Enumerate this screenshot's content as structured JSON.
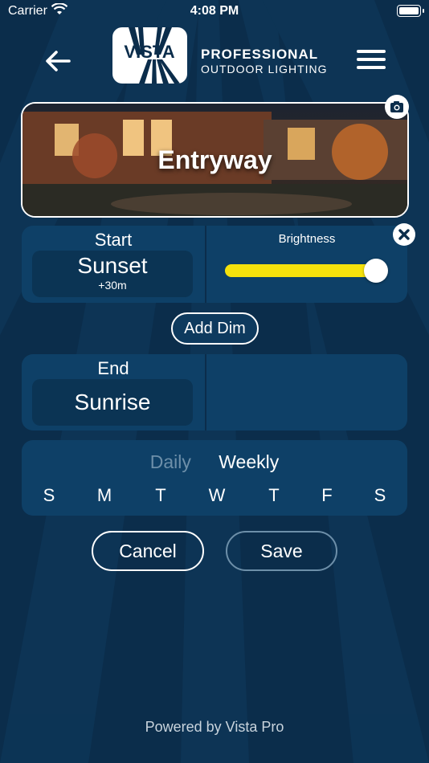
{
  "status_bar": {
    "carrier": "Carrier",
    "time": "4:08 PM"
  },
  "header": {
    "logo_text": "VISTA",
    "brand_line1": "PROFESSIONAL",
    "brand_line2": "OUTDOOR LIGHTING"
  },
  "hero": {
    "title": "Entryway"
  },
  "start": {
    "label": "Start",
    "value": "Sunset",
    "offset": "+30m",
    "brightness_label": "Brightness",
    "brightness_level": 1.0,
    "slider_color": "#f5e20c"
  },
  "add_dim_label": "Add Dim",
  "end": {
    "label": "End",
    "value": "Sunrise"
  },
  "schedule": {
    "tabs": [
      {
        "label": "Daily",
        "active": false
      },
      {
        "label": "Weekly",
        "active": true
      }
    ],
    "days": [
      "S",
      "M",
      "T",
      "W",
      "T",
      "F",
      "S"
    ]
  },
  "actions": {
    "cancel_label": "Cancel",
    "save_label": "Save"
  },
  "footer": "Powered by Vista Pro",
  "colors": {
    "background": "#0b2d4b",
    "card": "#0e4067",
    "accent": "#f5e20c"
  }
}
